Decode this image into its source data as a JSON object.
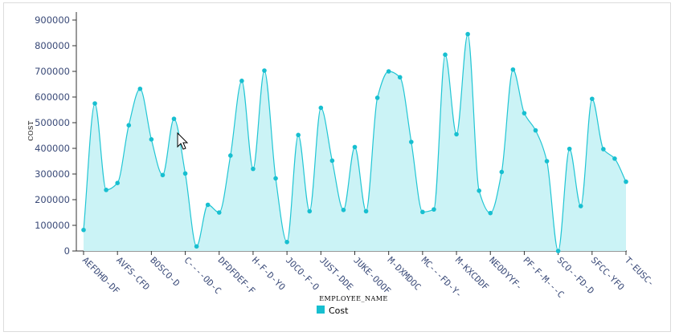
{
  "chart_data": {
    "type": "area",
    "xlabel": "EMPLOYEE_NAME",
    "ylabel": "COST",
    "ylim": [
      0,
      900000
    ],
    "yticks": [
      0,
      100000,
      200000,
      300000,
      400000,
      500000,
      600000,
      700000,
      800000,
      900000
    ],
    "grid": false,
    "legend_position": "bottom-center",
    "fill_color": "#cbf3f6",
    "line_color": "#22c6d4",
    "point_color": "#17bfd0",
    "series": [
      {
        "name": "Cost",
        "values": [
          82000,
          575000,
          238000,
          265000,
          490000,
          632000,
          435000,
          296000,
          515000,
          302000,
          18000,
          180000,
          150000,
          372000,
          663000,
          320000,
          703000,
          283000,
          35000,
          452000,
          155000,
          558000,
          352000,
          160000,
          405000,
          155000,
          597000,
          700000,
          677000,
          425000,
          152000,
          162000,
          765000,
          455000,
          845000,
          235000,
          148000,
          308000,
          707000,
          537000,
          470000,
          350000,
          0,
          398000,
          175000,
          593000,
          397000,
          360000,
          270000
        ]
      }
    ],
    "tick_labels": [
      "AEFDHD-DF",
      "AVFS-CFD",
      "BOSCO-D",
      "C----OD-C",
      "DFDFDEF-F",
      "H-F-D-YO",
      "JOCO-F-O",
      "JUST-DDE",
      "JUKE-OOOF",
      "M-DXMDOC",
      "MC---FD-Y-",
      "M-KXCDDF",
      "NEODYYF-",
      "PF-F-M---C",
      "SCO--FD-D",
      "SFCC-YFO",
      "T-EUSC-"
    ]
  }
}
